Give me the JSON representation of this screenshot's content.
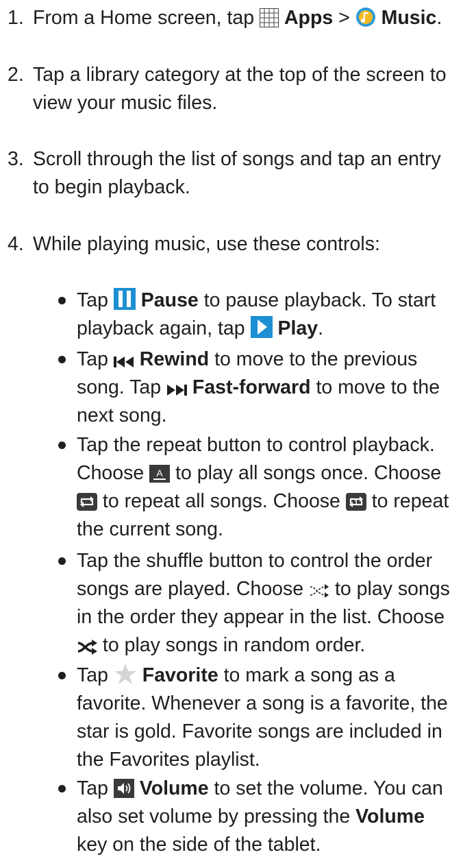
{
  "steps": [
    {
      "num": "1.",
      "t1": "From a Home screen, tap",
      "icon_apps": "apps-grid-icon",
      "b1": "Apps",
      "sep": ">",
      "icon_music": "music-note-icon",
      "b2": "Music",
      "end": "."
    },
    {
      "num": "2.",
      "text": "Tap a library category at the top of the screen to view your music files."
    },
    {
      "num": "3.",
      "text": "Scroll through the list of songs and tap an entry to begin playback."
    },
    {
      "num": "4.",
      "text": "While playing music, use these controls:"
    }
  ],
  "bullets": {
    "pause": {
      "t1": "Tap",
      "icon": "pause-icon",
      "b1": "Pause",
      "t2": "to pause playback. To start playback again, tap",
      "icon2": "play-icon",
      "b2": "Play",
      "end": "."
    },
    "rewind": {
      "t1": "Tap",
      "icon": "rewind-icon",
      "b1": "Rewind",
      "t2": "to move to the previous song. Tap",
      "icon2": "fast-forward-icon",
      "b2": "Fast-forward",
      "t3": "to move to the next song."
    },
    "repeat": {
      "t1": "Tap the repeat button to control playback. Choose",
      "icon1": "repeat-off-icon",
      "t2": "to play all songs once. Choose",
      "icon2": "repeat-all-icon",
      "t3": "to repeat all songs. Choose",
      "icon3": "repeat-one-icon",
      "t4": "to repeat the current song."
    },
    "shuffle": {
      "t1": "Tap the shuffle button to control the order songs are played. Choose",
      "icon1": "shuffle-off-icon",
      "t2": "to play songs in the order they appear in the list. Choose",
      "icon2": "shuffle-on-icon",
      "t3": "to play songs in random order."
    },
    "favorite": {
      "t1": "Tap",
      "icon": "star-icon",
      "b1": "Favorite",
      "t2": "to mark a song as a favorite. Whenever a song is a favorite, the star is gold. Favorite songs are included in the Favorites playlist."
    },
    "volume": {
      "t1": "Tap",
      "icon": "volume-icon",
      "b1": "Volume",
      "t2": "to set the volume. You can also set volume by pressing the",
      "b2": "Volume",
      "t3": "key on the side of the tablet."
    }
  }
}
